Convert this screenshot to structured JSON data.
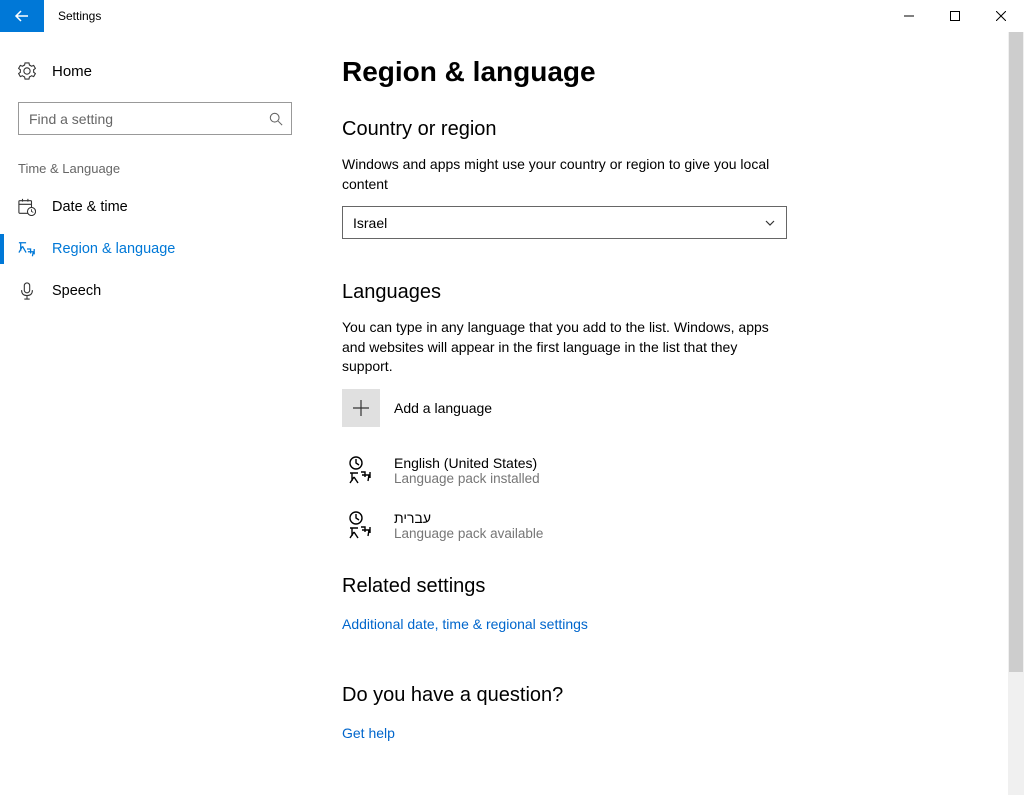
{
  "titlebar": {
    "title": "Settings"
  },
  "sidebar": {
    "home_label": "Home",
    "search_placeholder": "Find a setting",
    "category_label": "Time & Language",
    "items": [
      {
        "label": "Date & time",
        "active": false
      },
      {
        "label": "Region & language",
        "active": true
      },
      {
        "label": "Speech",
        "active": false
      }
    ]
  },
  "main": {
    "page_title": "Region & language",
    "country_section": {
      "title": "Country or region",
      "desc": "Windows and apps might use your country or region to give you local content",
      "value": "Israel"
    },
    "languages_section": {
      "title": "Languages",
      "desc": "You can type in any language that you add to the list. Windows, apps and websites will appear in the first language in the list that they support.",
      "add_label": "Add a language",
      "items": [
        {
          "name": "English (United States)",
          "status": "Language pack installed"
        },
        {
          "name": "עברית",
          "status": "Language pack available"
        }
      ]
    },
    "related_section": {
      "title": "Related settings",
      "link": "Additional date, time & regional settings"
    },
    "question_section": {
      "title": "Do you have a question?",
      "link": "Get help"
    }
  }
}
